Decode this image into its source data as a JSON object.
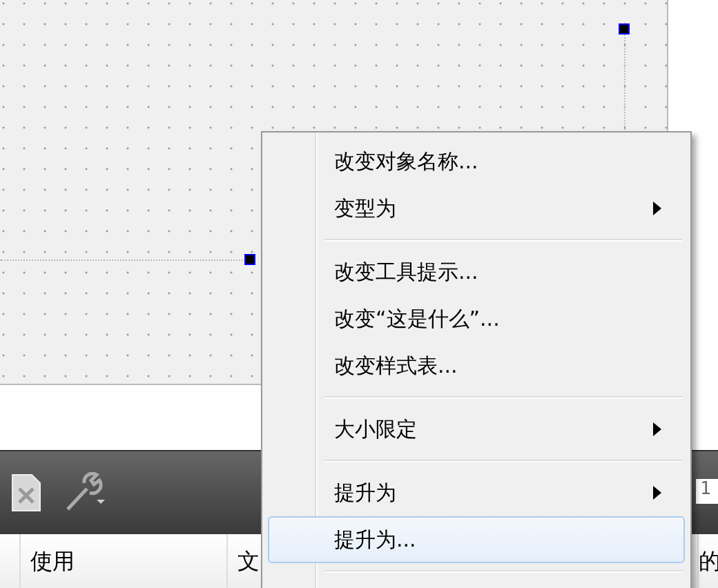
{
  "toolbar": {
    "side_field": {
      "value": "1"
    }
  },
  "table": {
    "columns": [
      "使用",
      "文",
      "的"
    ]
  },
  "context_menu": {
    "items": [
      {
        "kind": "item",
        "label": "改变对象名称...",
        "submenu": false,
        "selected": false
      },
      {
        "kind": "item",
        "label": "变型为",
        "submenu": true,
        "selected": false
      },
      {
        "kind": "separator"
      },
      {
        "kind": "item",
        "label": "改变工具提示...",
        "submenu": false,
        "selected": false
      },
      {
        "kind": "item",
        "label": "改变“这是什么”...",
        "submenu": false,
        "selected": false
      },
      {
        "kind": "item",
        "label": "改变样式表...",
        "submenu": false,
        "selected": false
      },
      {
        "kind": "separator"
      },
      {
        "kind": "item",
        "label": "大小限定",
        "submenu": true,
        "selected": false
      },
      {
        "kind": "separator"
      },
      {
        "kind": "item",
        "label": "提升为",
        "submenu": true,
        "selected": false
      },
      {
        "kind": "item",
        "label": "提升为...",
        "submenu": false,
        "selected": true
      },
      {
        "kind": "separator"
      }
    ]
  }
}
